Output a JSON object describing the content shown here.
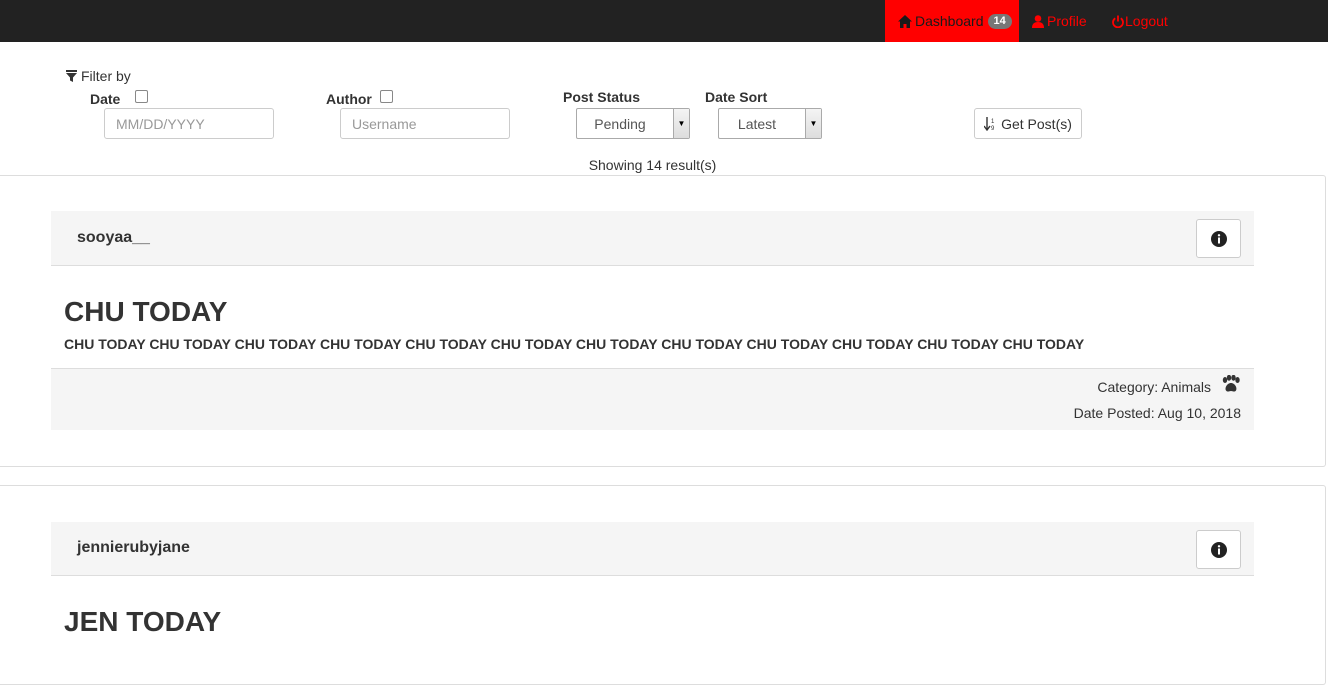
{
  "nav": {
    "dashboard_label": "Dashboard",
    "dashboard_badge": "14",
    "profile_label": "Profile",
    "logout_label": "Logout"
  },
  "filters": {
    "filter_by_label": "Filter by",
    "date_label": "Date",
    "date_placeholder": "MM/DD/YYYY",
    "author_label": "Author",
    "author_placeholder": "Username",
    "post_status_label": "Post Status",
    "post_status_value": "Pending",
    "date_sort_label": "Date Sort",
    "date_sort_value": "Latest",
    "get_posts_label": "Get Post(s)",
    "showing_text": "Showing 14 result(s)"
  },
  "posts": [
    {
      "author": "sooyaa__",
      "title": "CHU TODAY",
      "body": "CHU TODAY CHU TODAY CHU TODAY CHU TODAY CHU TODAY CHU TODAY CHU TODAY CHU TODAY CHU TODAY CHU TODAY CHU TODAY CHU TODAY",
      "category": "Category: Animals",
      "date_posted": "Date Posted: Aug 10, 2018"
    },
    {
      "author": "jennierubyjane",
      "title": "JEN TODAY"
    }
  ],
  "colors": {
    "navbar_bg": "#222222",
    "accent_red": "#ff0000",
    "panel_bg": "#f5f5f5"
  }
}
